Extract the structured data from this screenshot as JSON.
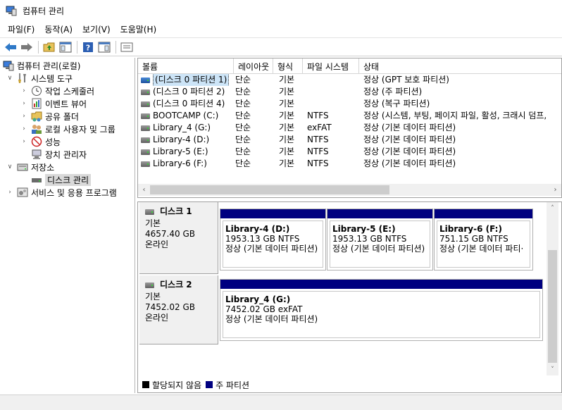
{
  "window": {
    "title": "컴퓨터 관리"
  },
  "menu": [
    "파일(F)",
    "동작(A)",
    "보기(V)",
    "도움말(H)"
  ],
  "toolbar": [
    "back-icon",
    "forward-icon",
    "up-folder-icon",
    "show-hide-tree-icon",
    "help-icon",
    "properties-icon",
    "console-icon"
  ],
  "tree": {
    "root": "컴퓨터 관리(로컬)",
    "system_tools": "시스템 도구",
    "task_scheduler": "작업 스케줄러",
    "event_viewer": "이벤트 뷰어",
    "shared_folders": "공유 폴더",
    "local_users": "로컬 사용자 및 그룹",
    "performance": "성능",
    "device_manager": "장치 관리자",
    "storage": "저장소",
    "disk_management": "디스크 관리",
    "services_apps": "서비스 및 응용 프로그램"
  },
  "volume_list": {
    "columns": [
      "볼륨",
      "레이아웃",
      "형식",
      "파일 시스템",
      "상태"
    ],
    "rows": [
      {
        "volume": "(디스크 0 파티션 1)",
        "layout": "단순",
        "type": "기본",
        "fs": "",
        "status": "정상 (GPT 보호 파티션)"
      },
      {
        "volume": "(디스크 0 파티션 2)",
        "layout": "단순",
        "type": "기본",
        "fs": "",
        "status": "정상 (주 파티션)"
      },
      {
        "volume": "(디스크 0 파티션 4)",
        "layout": "단순",
        "type": "기본",
        "fs": "",
        "status": "정상 (복구 파티션)"
      },
      {
        "volume": "BOOTCAMP (C:)",
        "layout": "단순",
        "type": "기본",
        "fs": "NTFS",
        "status": "정상 (시스템, 부팅, 페이지 파일, 활성, 크래시 덤프,"
      },
      {
        "volume": "Library_4 (G:)",
        "layout": "단순",
        "type": "기본",
        "fs": "exFAT",
        "status": "정상 (기본 데이터 파티션)"
      },
      {
        "volume": "Library-4 (D:)",
        "layout": "단순",
        "type": "기본",
        "fs": "NTFS",
        "status": "정상 (기본 데이터 파티션)"
      },
      {
        "volume": "Library-5 (E:)",
        "layout": "단순",
        "type": "기본",
        "fs": "NTFS",
        "status": "정상 (기본 데이터 파티션)"
      },
      {
        "volume": "Library-6 (F:)",
        "layout": "단순",
        "type": "기본",
        "fs": "NTFS",
        "status": "정상 (기본 데이터 파티션)"
      }
    ]
  },
  "disks": [
    {
      "name": "디스크 1",
      "type": "기본",
      "size": "4657.40 GB",
      "state": "온라인",
      "partitions": [
        {
          "name": "Library-4  (D:)",
          "size": "1953.13 GB NTFS",
          "status": "정상 (기본 데이터 파티션)"
        },
        {
          "name": "Library-5  (E:)",
          "size": "1953.13 GB NTFS",
          "status": "정상 (기본 데이터 파티션)"
        },
        {
          "name": "Library-6  (F:)",
          "size": "751.15 GB NTFS",
          "status": "정상 (기본 데이터 파티·"
        }
      ]
    },
    {
      "name": "디스크 2",
      "type": "기본",
      "size": "7452.02 GB",
      "state": "온라인",
      "partitions": [
        {
          "name": "Library_4  (G:)",
          "size": "7452.02 GB exFAT",
          "status": "정상 (기본 데이터 파티션)"
        }
      ]
    }
  ],
  "legend": {
    "unallocated": "할당되지 않음",
    "primary": "주 파티션",
    "unallocated_color": "#000000",
    "primary_color": "#000080"
  }
}
